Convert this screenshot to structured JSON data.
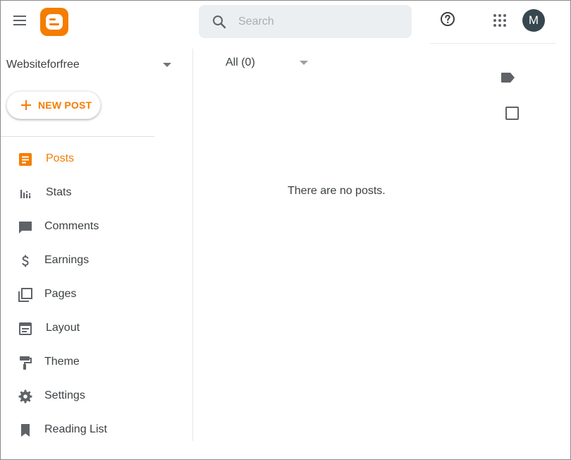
{
  "header": {
    "search_placeholder": "Search",
    "avatar_initial": "M",
    "brand_color": "#f57d00"
  },
  "sidebar": {
    "blog_name": "Websiteforfree",
    "new_post_label": "NEW POST",
    "items": [
      {
        "label": "Posts",
        "icon": "posts-icon",
        "active": true
      },
      {
        "label": "Stats",
        "icon": "stats-icon",
        "active": false
      },
      {
        "label": "Comments",
        "icon": "comments-icon",
        "active": false
      },
      {
        "label": "Earnings",
        "icon": "earnings-icon",
        "active": false
      },
      {
        "label": "Pages",
        "icon": "pages-icon",
        "active": false
      },
      {
        "label": "Layout",
        "icon": "layout-icon",
        "active": false
      },
      {
        "label": "Theme",
        "icon": "theme-icon",
        "active": false
      },
      {
        "label": "Settings",
        "icon": "settings-icon",
        "active": false
      },
      {
        "label": "Reading List",
        "icon": "reading-list-icon",
        "active": false
      }
    ]
  },
  "main": {
    "filter_label": "All (0)",
    "empty_message": "There are no posts."
  },
  "colors": {
    "accent": "#f57d00",
    "icon_gray": "#5f6368",
    "search_bg": "#eceff1",
    "avatar_bg": "#37474f"
  }
}
